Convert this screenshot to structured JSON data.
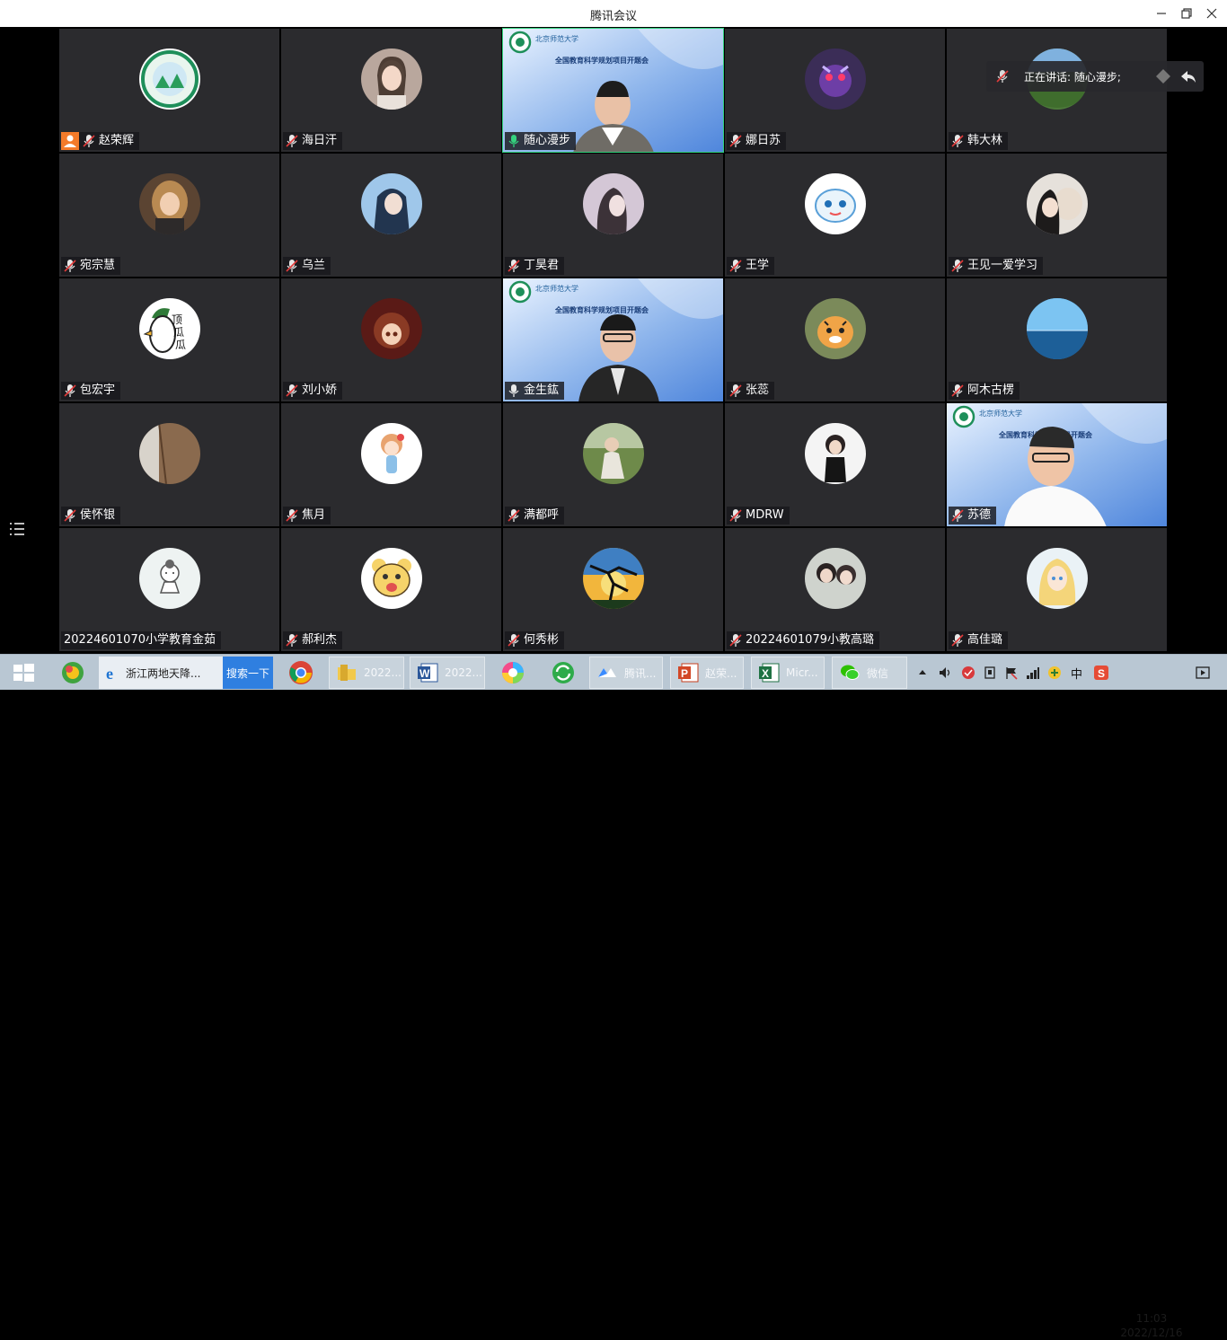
{
  "window": {
    "title": "腾讯会议",
    "controls": [
      "minimize-icon",
      "restore-icon",
      "close-icon"
    ]
  },
  "speaking_indicator": {
    "text": "正在讲话: 随心漫步;"
  },
  "slide_text": {
    "university": "北京师范大学",
    "conference": "全国教育科学规划项目开题会"
  },
  "participants": [
    {
      "name": "赵荣辉",
      "host": true,
      "avatar": "green-emblem",
      "muted": true
    },
    {
      "name": "海日汗",
      "avatar": "woman-portrait",
      "muted": true
    },
    {
      "name": "随心漫步",
      "avatar": "video",
      "muted": false,
      "speaking": true
    },
    {
      "name": "娜日苏",
      "avatar": "purple-monster",
      "muted": true
    },
    {
      "name": "韩大林",
      "avatar": "green-nature",
      "muted": true
    },
    {
      "name": "宛宗慧",
      "avatar": "girl-blonde",
      "muted": true
    },
    {
      "name": "乌兰",
      "avatar": "blue-hair-girl",
      "muted": true
    },
    {
      "name": "丁昊君",
      "avatar": "girl-soft",
      "muted": true
    },
    {
      "name": "王学",
      "avatar": "cartoon-white-cat",
      "muted": true
    },
    {
      "name": "王见一爱学习",
      "avatar": "girl-with-plush",
      "muted": true
    },
    {
      "name": "包宏宇",
      "avatar": "duck-watermelon",
      "muted": true
    },
    {
      "name": "刘小娇",
      "avatar": "anime-girl-red",
      "muted": true
    },
    {
      "name": "金生鈜",
      "avatar": "video",
      "muted": false
    },
    {
      "name": "张蕊",
      "avatar": "tiger-cartoon",
      "muted": true
    },
    {
      "name": "阿木古楞",
      "avatar": "sea-horizon",
      "muted": true
    },
    {
      "name": "侯怀银",
      "avatar": "wood-door",
      "muted": true
    },
    {
      "name": "焦月",
      "avatar": "cartoon-girl-flower",
      "muted": true
    },
    {
      "name": "满都呼",
      "avatar": "boy-outdoor",
      "muted": true
    },
    {
      "name": "MDRW",
      "avatar": "child-photo",
      "muted": true
    },
    {
      "name": "苏德",
      "avatar": "video",
      "muted": true
    },
    {
      "name": "20224601070小学教育金茹",
      "avatar": "cartoon-sketch",
      "muted": false,
      "no_icon": true
    },
    {
      "name": "郝利杰",
      "avatar": "bear-cartoon",
      "muted": true
    },
    {
      "name": "何秀彬",
      "avatar": "dancer-silhouette",
      "muted": true
    },
    {
      "name": "20224601079小教高璐",
      "avatar": "two-girls",
      "muted": true
    },
    {
      "name": "高佳璐",
      "avatar": "anime-blonde",
      "muted": true
    }
  ],
  "taskbar": {
    "start_icon": "windows-logo-icon",
    "search_text": "浙江两地天降...",
    "search_button": "搜索一下",
    "windows": [
      {
        "label": "2022...",
        "icon": "folder-icon"
      },
      {
        "label": "2022...",
        "icon": "word-icon"
      },
      {
        "label": "腾讯...",
        "icon": "tencent-meeting-icon"
      },
      {
        "label": "赵荣...",
        "icon": "powerpoint-icon"
      },
      {
        "label": "Micr...",
        "icon": "excel-icon"
      },
      {
        "label": "微信",
        "icon": "wechat-icon"
      }
    ],
    "ime": "中",
    "time": "11:03",
    "date": "2022/12/16"
  },
  "colors": {
    "tile_bg": "#2b2b2e",
    "speaking_border": "#2fd07a",
    "host_badge": "#f47b2a",
    "taskbar_bg": "#b9c7d3",
    "search_button_bg": "#2f7fe0"
  }
}
